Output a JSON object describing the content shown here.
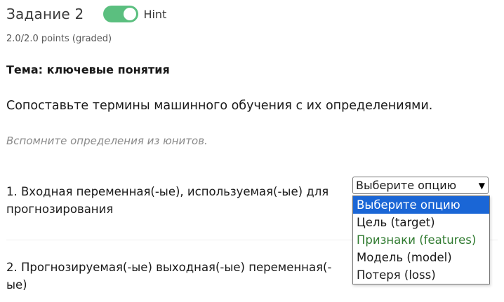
{
  "header": {
    "title": "Задание 2",
    "hint_label": "Hint",
    "hint_on": true
  },
  "points": "2.0/2.0 points (graded)",
  "topic": "Тема: ключевые понятия",
  "instruction": "Сопоставьте термины машинного обучения с их определениями.",
  "hint_text": "Вспомните определения из юнитов.",
  "questions": [
    {
      "text": "1. Входная переменная(-ые), используемая(-ые) для прогнозирования"
    },
    {
      "text": "2. Прогнозируемая(-ые) выходная(-ые) переменная(-ые)"
    }
  ],
  "select": {
    "value": "Выберите опцию",
    "options": [
      {
        "label": "Выберите опцию",
        "state": "highlighted"
      },
      {
        "label": "Цель (target)",
        "state": "normal"
      },
      {
        "label": "Признаки (features)",
        "state": "green"
      },
      {
        "label": "Модель (model)",
        "state": "normal"
      },
      {
        "label": "Потеря (loss)",
        "state": "normal"
      }
    ]
  },
  "colors": {
    "toggle_on": "#5bbf7f",
    "option_highlight": "#1a66d6",
    "option_green": "#2f7a2f"
  },
  "icons": {
    "toggle": "toggle-switch-on",
    "select_chevron": "chevron-down-icon"
  }
}
